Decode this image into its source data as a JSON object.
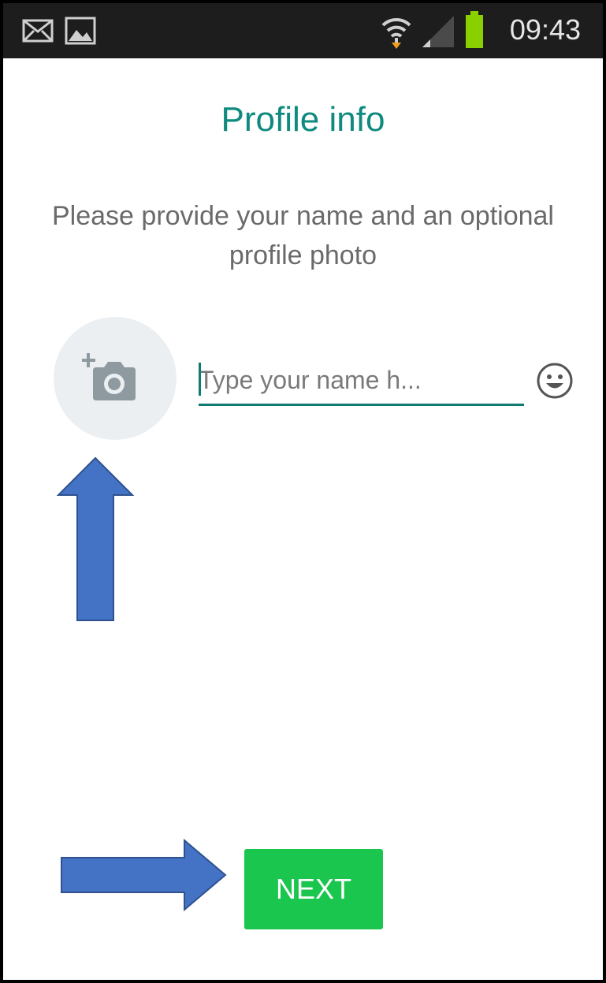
{
  "status_bar": {
    "time": "09:43",
    "icons": [
      "mail-icon",
      "image-icon",
      "wifi-icon",
      "signal-icon",
      "battery-icon"
    ]
  },
  "profile": {
    "title": "Profile info",
    "subtitle": "Please provide your name and an optional profile photo",
    "name_placeholder": "Type your name h...",
    "photo_icon": "add-photo-camera-icon",
    "emoji_icon": "smiley-face-icon"
  },
  "actions": {
    "next_label": "NEXT"
  },
  "annotations": {
    "arrow_color": "#4472c4",
    "arrows": [
      "up-arrow-to-photo",
      "right-arrow-to-next"
    ]
  },
  "colors": {
    "title": "#0e8a7e",
    "accent": "#0e7a70",
    "button": "#1ac64e",
    "status_bar": "#1d1d1d"
  }
}
